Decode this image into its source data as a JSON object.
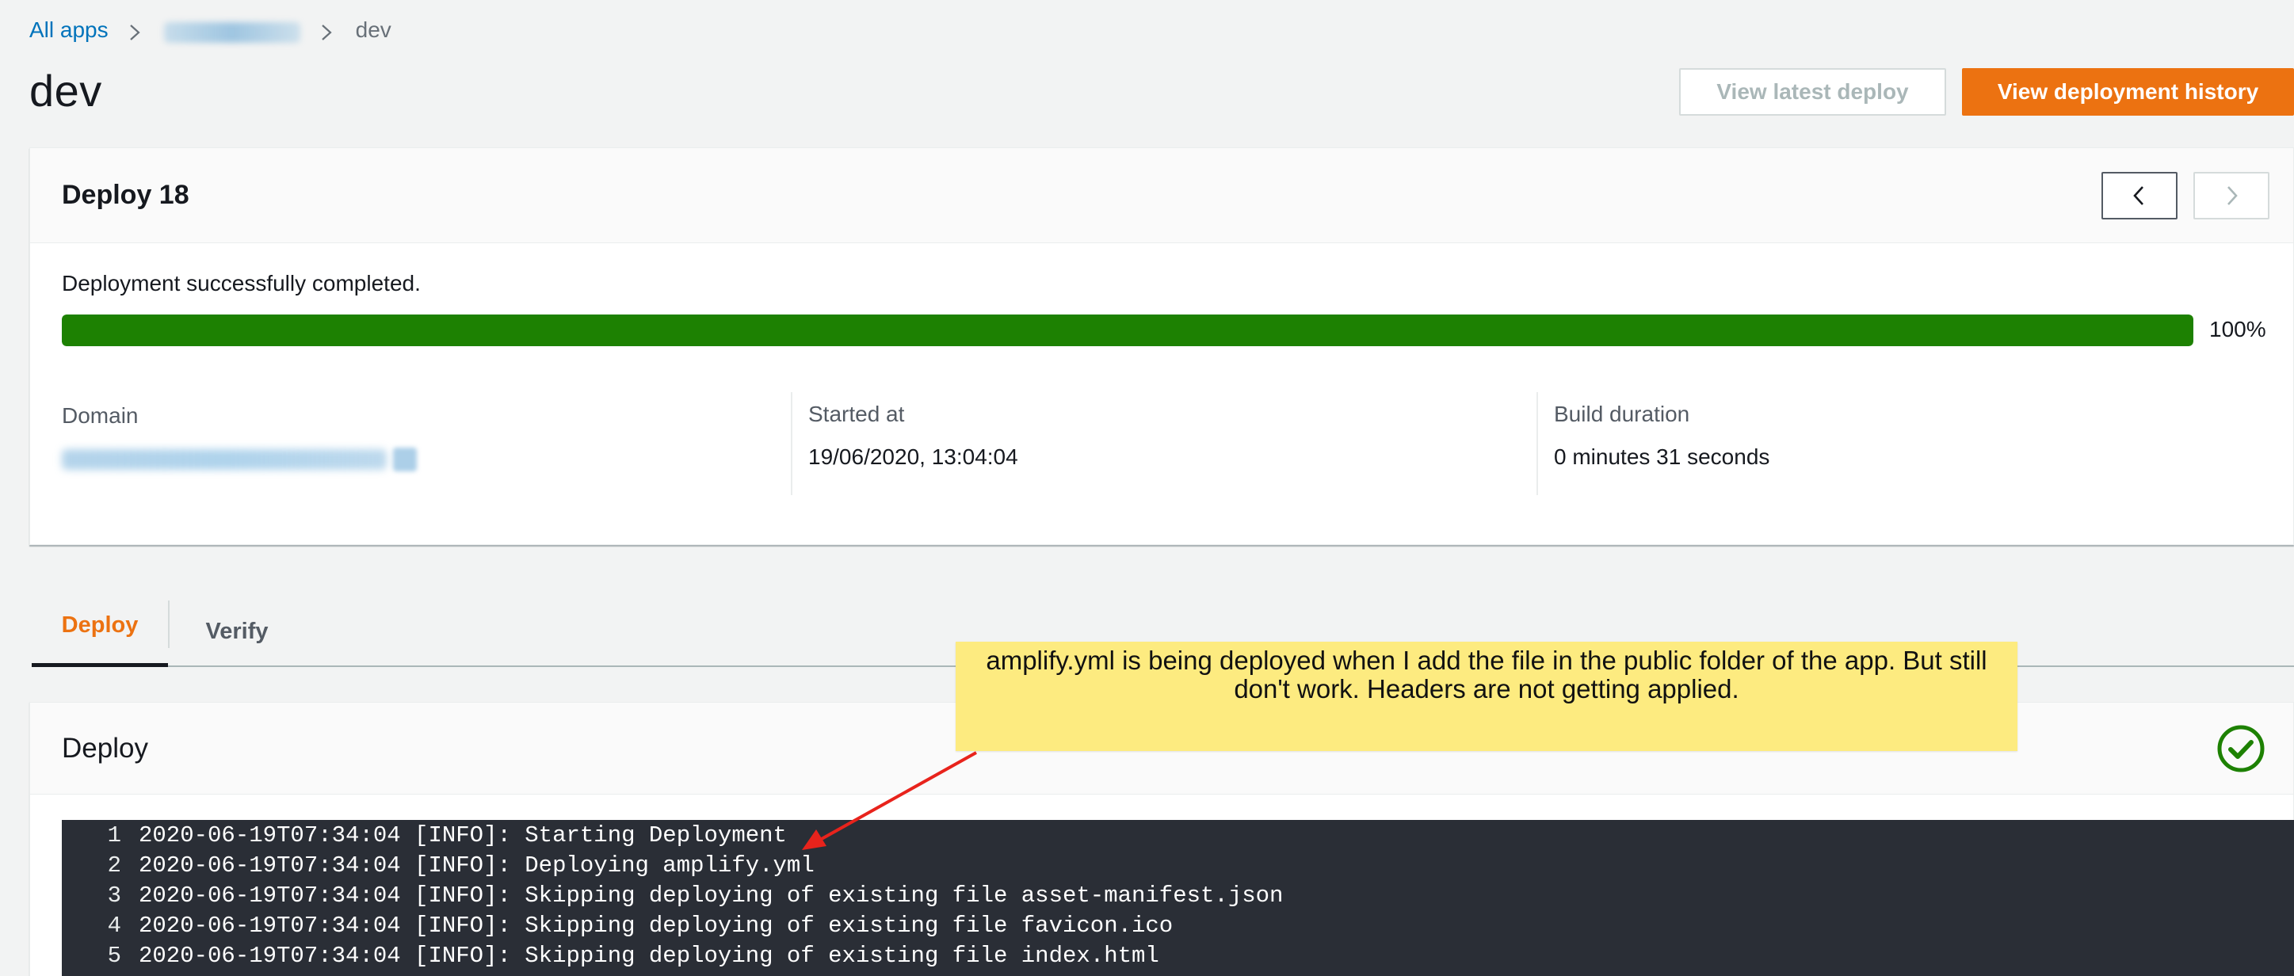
{
  "breadcrumb": {
    "all_apps": "All apps",
    "current": "dev"
  },
  "page_title": "dev",
  "actions": {
    "view_latest": "View latest deploy",
    "view_history": "View deployment history"
  },
  "deploy_card": {
    "title": "Deploy 18",
    "status_message": "Deployment successfully completed.",
    "progress_percent": 100,
    "progress_label": "100%",
    "domain_label": "Domain",
    "started_label": "Started at",
    "started_value": "19/06/2020, 13:04:04",
    "duration_label": "Build duration",
    "duration_value": "0 minutes 31 seconds"
  },
  "tabs": [
    {
      "label": "Deploy",
      "active": true
    },
    {
      "label": "Verify",
      "active": false
    }
  ],
  "log_card": {
    "title": "Deploy",
    "status_icon": "check-circle-icon",
    "lines": [
      {
        "num": "1",
        "text": "2020-06-19T07:34:04 [INFO]: Starting Deployment"
      },
      {
        "num": "2",
        "text": "2020-06-19T07:34:04 [INFO]: Deploying amplify.yml"
      },
      {
        "num": "3",
        "text": "2020-06-19T07:34:04 [INFO]: Skipping deploying of existing file asset-manifest.json"
      },
      {
        "num": "4",
        "text": "2020-06-19T07:34:04 [INFO]: Skipping deploying of existing file favicon.ico"
      },
      {
        "num": "5",
        "text": "2020-06-19T07:34:04 [INFO]: Skipping deploying of existing file index.html"
      }
    ]
  },
  "annotation": {
    "text": "amplify.yml is being deployed when I add the file in the public folder of the app. But still don't work. Headers are not getting applied."
  },
  "colors": {
    "accent": "#ec7211",
    "link": "#0073bb",
    "success": "#1d8102",
    "log_bg": "#2a2e36",
    "annotation_bg": "#fdeb80",
    "arrow": "#e8231c"
  }
}
